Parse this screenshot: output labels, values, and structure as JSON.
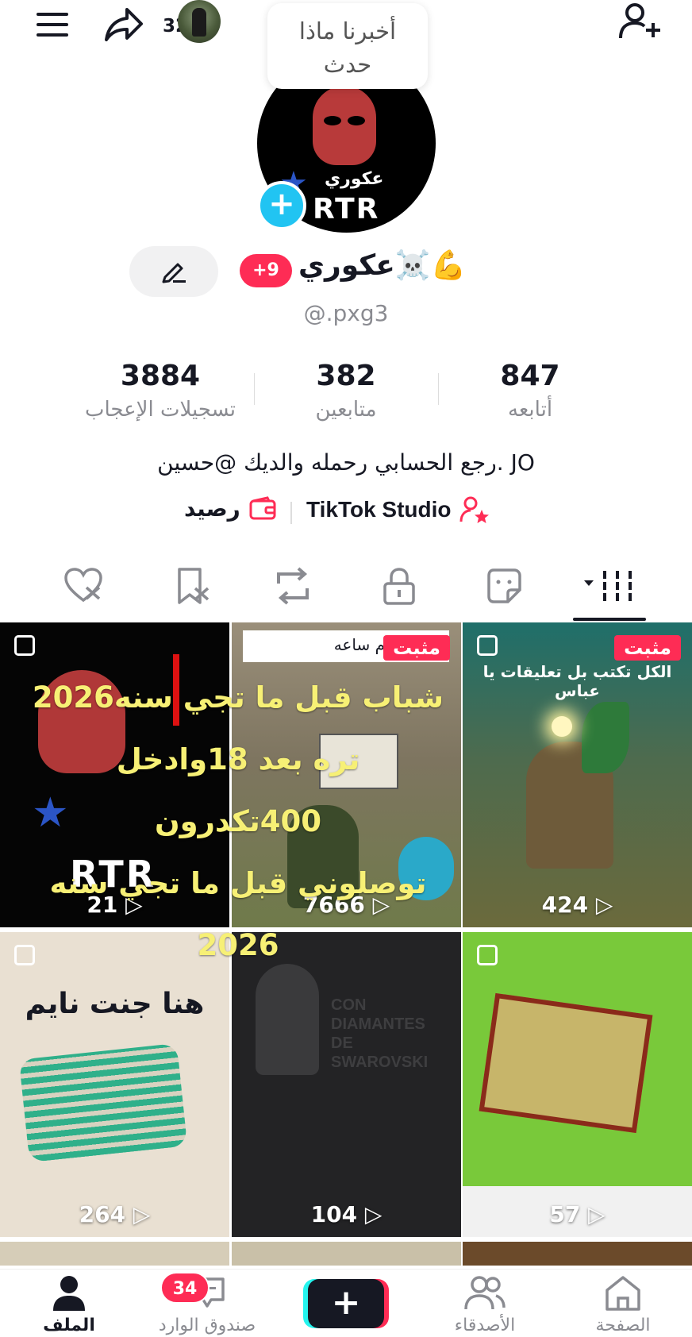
{
  "header": {
    "story_count": "32",
    "tooltip_line1": "أخبرنا ماذا",
    "tooltip_line2": "حدث"
  },
  "avatar": {
    "name_text": "عكوري",
    "logo_text": "RTR"
  },
  "profile": {
    "display_name": "عكوري☠️💪",
    "notification_badge": "+9",
    "username": "@.pxg3",
    "bio": "رجع الحسابي رحمله والديك @حسين. JO"
  },
  "stats": {
    "likes_value": "3884",
    "likes_label": "تسجيلات الإعجاب",
    "followers_value": "382",
    "followers_label": "متابعين",
    "following_value": "847",
    "following_label": "أتابعه"
  },
  "links": {
    "studio_label": "TikTok Studio",
    "balance_label": "رصيد"
  },
  "tabs": [
    "liked",
    "favorites",
    "reposts",
    "private",
    "stickers",
    "videos"
  ],
  "grid": {
    "pinned_label": "مثبت",
    "overlay_caption_line1": "شباب قبل ما تجي سنه2026",
    "overlay_caption_line2": "تره بعد 18وادخل 400تكدرون",
    "overlay_caption_line3": "توصلوني قبل ما تجي سنه",
    "overlay_caption_line4": "2026",
    "items": [
      {
        "views": "21"
      },
      {
        "views": "7666",
        "top_caption": "ذ صفنه ام ساعه"
      },
      {
        "views": "424",
        "top_caption": "الكل تكتب بل تعليقات يا عباس"
      },
      {
        "views": "264",
        "caption": "هنا جنت نايم"
      },
      {
        "views": "104",
        "caption": "CON DIAMANTES DE SWAROVSKI"
      },
      {
        "views": "57"
      }
    ]
  },
  "bottom_nav": {
    "home": "الصفحة الرئيسية",
    "friends": "الأصدقاء",
    "inbox": "صندوق الوارد",
    "inbox_badge": "34",
    "profile": "الملف الشخصي"
  },
  "colors": {
    "accent": "#fe2c55",
    "cyan": "#25f4ee",
    "avatar_add": "#21c4f2",
    "text": "#161823",
    "muted": "#8a8b91"
  }
}
